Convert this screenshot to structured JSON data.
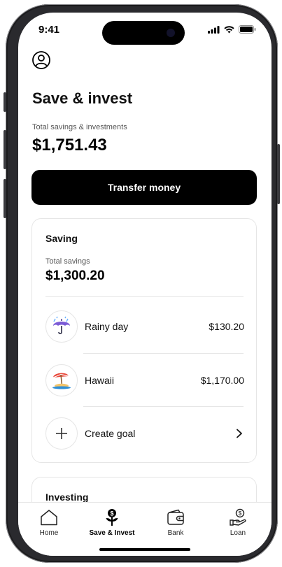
{
  "status_bar": {
    "time": "9:41"
  },
  "page": {
    "title": "Save & invest",
    "total_label": "Total savings & investments",
    "total_amount": "$1,751.43",
    "transfer_button": "Transfer money"
  },
  "saving_card": {
    "title": "Saving",
    "total_label": "Total savings",
    "total_amount": "$1,300.20",
    "goals": [
      {
        "label": "Rainy day",
        "value": "$130.20",
        "icon": "umbrella-icon"
      },
      {
        "label": "Hawaii",
        "value": "$1,170.00",
        "icon": "island-icon"
      }
    ],
    "create_goal": "Create goal"
  },
  "investing_card": {
    "title": "Investing"
  },
  "tabbar": {
    "tabs": [
      {
        "label": "Home",
        "icon": "home-icon"
      },
      {
        "label": "Save & Invest",
        "icon": "save-invest-icon",
        "active": true
      },
      {
        "label": "Bank",
        "icon": "wallet-icon"
      },
      {
        "label": "Loan",
        "icon": "loan-icon"
      }
    ]
  },
  "colors": {
    "accent": "#000000",
    "divider": "#e6e6e6",
    "umbrella": "#7b5bd6",
    "beach": "#e8483a"
  }
}
